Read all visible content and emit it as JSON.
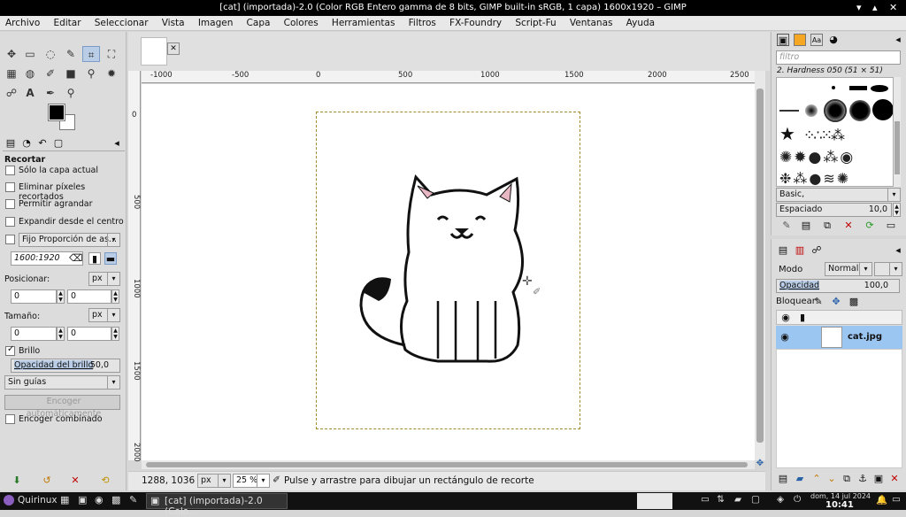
{
  "window_title": "[cat] (importada)-2.0 (Color RGB Entero gamma de 8 bits, GIMP built-in sRGB, 1 capa) 1600x1920 – GIMP",
  "menu": [
    "Archivo",
    "Editar",
    "Seleccionar",
    "Vista",
    "Imagen",
    "Capa",
    "Colores",
    "Herramientas",
    "Filtros",
    "FX-Foundry",
    "Script-Fu",
    "Ventanas",
    "Ayuda"
  ],
  "tool_options": {
    "title": "Recortar",
    "current_layer_only": "Sólo la capa actual",
    "delete_cropped": "Eliminar píxeles recortados",
    "allow_growing": "Permitir agrandar",
    "expand_center": "Expandir desde el centro",
    "fixed_label": "Fijo",
    "fixed_mode": "Proporción de as...",
    "ratio_value": "1600:1920",
    "position_label": "Posicionar:",
    "position_unit": "px",
    "pos_x": "0",
    "pos_y": "0",
    "size_label": "Tamaño:",
    "size_unit": "px",
    "size_w": "0",
    "size_h": "0",
    "highlight": "Brillo",
    "highlight_opacity_label": "Opacidad del brillo",
    "highlight_opacity_value": "50,0",
    "guides": "Sin guías",
    "auto_shrink": "Encoger automáticamente",
    "shrink_merged": "Encoger combinado"
  },
  "ruler_top": [
    "-1000",
    "-500",
    "0",
    "500",
    "1000",
    "1500",
    "2000",
    "2500"
  ],
  "ruler_left": [
    "0",
    "500",
    "1000",
    "1500",
    "2000"
  ],
  "statusbar": {
    "coords": "1288, 1036",
    "unit": "px",
    "zoom": "25 %",
    "message": "Pulse y arrastre para dibujar un rectángulo de recorte"
  },
  "brushes": {
    "filter_placeholder": "filtro",
    "current": "2. Hardness 050 (51 × 51)",
    "preset": "Basic,",
    "spacing_label": "Espaciado",
    "spacing_value": "10,0"
  },
  "layers": {
    "mode_label": "Modo",
    "mode_value": "Normal",
    "opacity_label": "Opacidad",
    "opacity_value": "100,0",
    "lock_label": "Bloquear:",
    "layer_name": "cat.jpg"
  },
  "taskbar": {
    "start": "Quirinux",
    "window": "[cat] (importada)-2.0 (Colo...",
    "date": "dom, 14 jul 2024",
    "time": "10:41"
  },
  "colors": {
    "accent": "#9cc6f2",
    "selection_dash": "#a08b2c"
  }
}
